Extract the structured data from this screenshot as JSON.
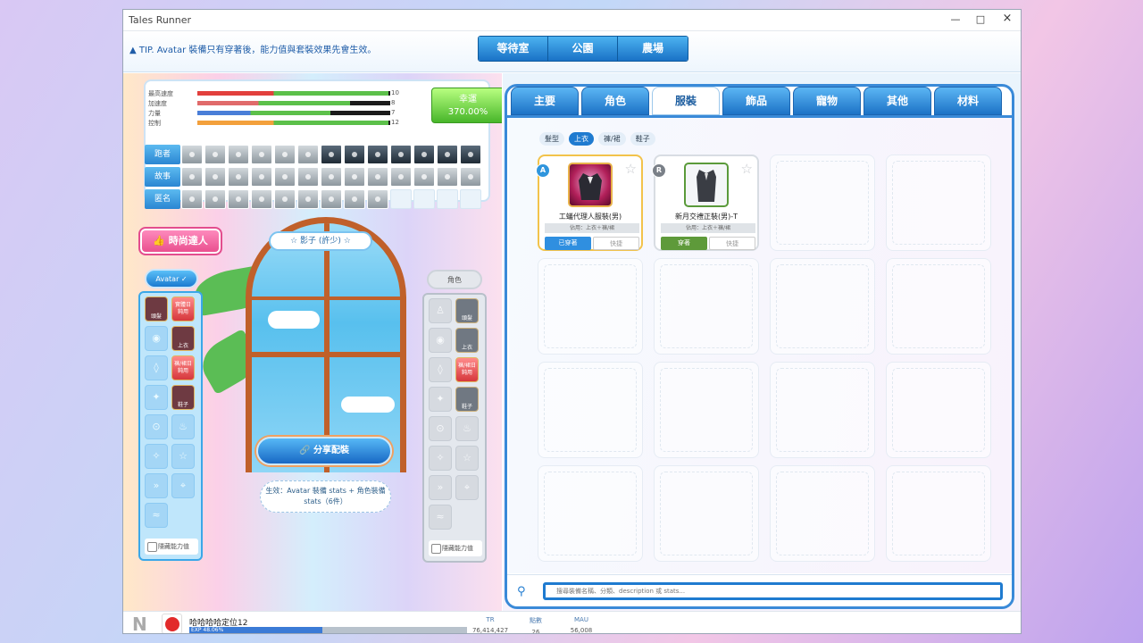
{
  "window": {
    "title": "Tales Runner",
    "minimize": "—",
    "maximize": "□",
    "close": "×"
  },
  "topbar": {
    "tip": "▲ TIP. Avatar 裝備只有穿著後，能力值與套裝效果先會生效。",
    "nav": [
      "等待室",
      "公園",
      "農場"
    ]
  },
  "stats": [
    {
      "label": "最高速度",
      "value": "10",
      "fill": 0.99,
      "color": "#e2403d"
    },
    {
      "label": "加速度",
      "value": "8",
      "fill": 0.79,
      "color": "#e06a6a"
    },
    {
      "label": "力量",
      "value": "7",
      "fill": 0.69,
      "color": "#4a7ed8"
    },
    {
      "label": "控制",
      "value": "12",
      "fill": 0.99,
      "color": "#f3a03c"
    }
  ],
  "luck": {
    "label": "幸運",
    "value": "370.00%"
  },
  "grid_rows": [
    "跑者",
    "故事",
    "匿名"
  ],
  "fashion_button": "👍 時尚達人",
  "left_filter": "Avatar ✓",
  "right_filter": "角色",
  "left_slots": [
    {
      "label": "頭髮",
      "type": "item"
    },
    {
      "label": "實體日\n鈍用",
      "type": "red"
    },
    {
      "label": "◉",
      "type": "empty"
    },
    {
      "label": "上衣",
      "type": "item"
    },
    {
      "label": "◊",
      "type": "empty"
    },
    {
      "label": "褲/裙日\n鈍用",
      "type": "red"
    },
    {
      "label": "✦",
      "type": "empty"
    },
    {
      "label": "鞋子",
      "type": "item"
    },
    {
      "label": "⊙",
      "type": "empty"
    },
    {
      "label": "♨",
      "type": "empty"
    },
    {
      "label": "✧",
      "type": "empty"
    },
    {
      "label": "☆",
      "type": "empty"
    },
    {
      "label": "»",
      "type": "empty"
    },
    {
      "label": "⌖",
      "type": "empty"
    },
    {
      "label": "≈",
      "type": "empty"
    }
  ],
  "right_slots": [
    {
      "label": "♙",
      "type": "empty"
    },
    {
      "label": "頭髮",
      "type": "item"
    },
    {
      "label": "◉",
      "type": "empty"
    },
    {
      "label": "上衣",
      "type": "item"
    },
    {
      "label": "◊",
      "type": "empty"
    },
    {
      "label": "褲/裙日\n鈍用",
      "type": "red"
    },
    {
      "label": "✦",
      "type": "empty"
    },
    {
      "label": "鞋子",
      "type": "item"
    },
    {
      "label": "⊙",
      "type": "empty"
    },
    {
      "label": "♨",
      "type": "empty"
    },
    {
      "label": "✧",
      "type": "empty"
    },
    {
      "label": "☆",
      "type": "empty"
    },
    {
      "label": "»",
      "type": "empty"
    },
    {
      "label": "⌖",
      "type": "empty"
    },
    {
      "label": "≈",
      "type": "empty"
    }
  ],
  "hide_stats_left": "隱藏能力值",
  "hide_stats_right": "隱藏能力值",
  "shadow_label": "☆ 影子 (許少) ☆",
  "share_button": "🔗 分享配裝",
  "note": "生效：Avatar 裝備 stats + 角色裝備 stats（6件）",
  "tabs": [
    "主要",
    "角色",
    "服裝",
    "飾品",
    "寵物",
    "其他",
    "材料"
  ],
  "subtabs": [
    "髮型",
    "上衣",
    "褲/裙",
    "鞋子"
  ],
  "items": [
    {
      "badge": "A",
      "badge_color": "#2f95dd",
      "name": "工蟻代理人服裝(男)",
      "sub": "佔用：上衣＋褲/裙",
      "primary": "已穿著",
      "primary_color": "#2f8fe0",
      "secondary": "快捷",
      "star": "☆"
    },
    {
      "badge": "R",
      "badge_color": "#7a8088",
      "name": "新月交禮正裝(男)-T",
      "sub": "佔用：上衣＋褲/裙",
      "primary": "穿著",
      "primary_color": "#5e9a3a",
      "secondary": "快捷",
      "star": "☆"
    }
  ],
  "search": {
    "icon": "⚲",
    "placeholder": "搜尋裝備名稱、分類、description 或 stats..."
  },
  "status": {
    "logo": "N",
    "username": "哈哈哈哈定位12",
    "exp_label": "EXP 48.06%",
    "exp_fill": 0.48,
    "cols": [
      {
        "label": "TR",
        "value": "76,414,427"
      },
      {
        "label": "點數",
        "value": "26"
      },
      {
        "label": "MAU",
        "value": "56,008"
      }
    ]
  }
}
